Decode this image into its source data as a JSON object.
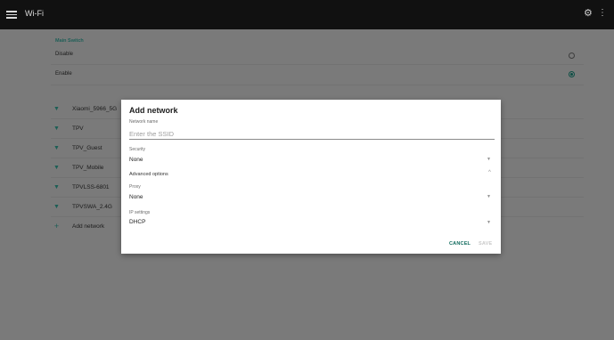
{
  "topbar": {
    "title": "Wi-Fi",
    "settings_icon": "gear-icon",
    "overflow_icon": "more-vert-icon"
  },
  "main_switch": {
    "section_title": "Main Switch",
    "options": [
      {
        "label": "Disable",
        "selected": false
      },
      {
        "label": "Enable",
        "selected": true
      }
    ]
  },
  "networks": [
    {
      "label": "Xiaomi_5966_5G",
      "icon": "wifi-icon"
    },
    {
      "label": "TPV",
      "icon": "wifi-icon"
    },
    {
      "label": "TPV_Guest",
      "icon": "wifi-icon"
    },
    {
      "label": "TPV_Mobile",
      "icon": "wifi-icon"
    },
    {
      "label": "TPVLSS-6801",
      "icon": "wifi-icon"
    },
    {
      "label": "TPVSWA_2.4G",
      "icon": "wifi-icon"
    },
    {
      "label": "Add network",
      "icon": "plus-icon"
    }
  ],
  "dialog": {
    "title": "Add network",
    "network_name_label": "Network name",
    "network_name_placeholder": "Enter the SSID",
    "security_label": "Security",
    "security_value": "None",
    "advanced_label": "Advanced options",
    "proxy_label": "Proxy",
    "proxy_value": "None",
    "ip_label": "IP settings",
    "ip_value": "DHCP",
    "cancel_label": "CANCEL",
    "save_label": "SAVE"
  },
  "colors": {
    "accent": "#0f6a5d",
    "topbar": "#111111",
    "scrim": "#787878"
  }
}
